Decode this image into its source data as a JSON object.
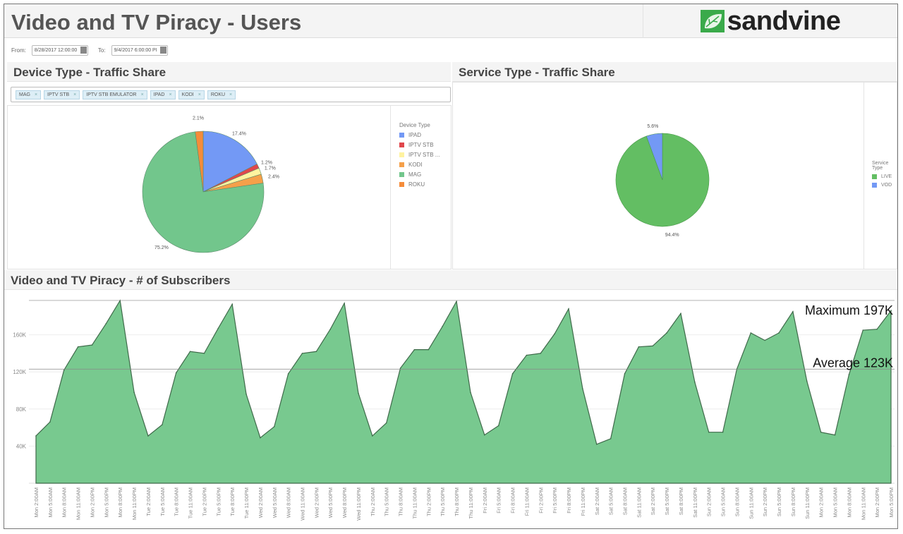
{
  "header": {
    "title": "Video and TV Piracy - Users",
    "logo_text": "sandvine"
  },
  "filter": {
    "from_label": "From:",
    "from_value": "8/28/2017 12:00:00",
    "to_label": "To:",
    "to_value": "9/4/2017 6:00:00 PI"
  },
  "device_panel": {
    "title": "Device Type - Traffic Share",
    "chips": [
      "MAG",
      "IPTV STB",
      "IPTV STB EMULATOR",
      "IPAD",
      "KODI",
      "ROKU"
    ],
    "legend_title": "Device Type",
    "chart_data": {
      "type": "pie",
      "slices": [
        {
          "name": "IPAD",
          "legend": "IPAD",
          "value": 17.4,
          "label": "17.4%",
          "color": "#7399f5"
        },
        {
          "name": "IPTV STB",
          "legend": "IPTV STB",
          "value": 1.2,
          "label": "1.2%",
          "color": "#e0474c"
        },
        {
          "name": "IPTV STB EMULATOR",
          "legend": "IPTV STB ...",
          "value": 1.7,
          "label": "1.7%",
          "color": "#fff3a0"
        },
        {
          "name": "KODI",
          "legend": "KODI",
          "value": 2.4,
          "label": "2.4%",
          "color": "#f5a04a"
        },
        {
          "name": "MAG",
          "legend": "MAG",
          "value": 75.2,
          "label": "75.2%",
          "color": "#72c68c"
        },
        {
          "name": "ROKU",
          "legend": "ROKU",
          "value": 2.1,
          "label": "2.1%",
          "color": "#f58c3a"
        }
      ]
    }
  },
  "service_panel": {
    "title": "Service Type - Traffic Share",
    "legend_title_1": "Service",
    "legend_title_2": "Type",
    "chart_data": {
      "type": "pie",
      "slices": [
        {
          "name": "LIVE",
          "value": 94.4,
          "label": "94.4%",
          "color": "#63be63"
        },
        {
          "name": "VOD",
          "value": 5.6,
          "label": "5.6%",
          "color": "#7399f5"
        }
      ]
    }
  },
  "subscribers_panel": {
    "title": "Video and TV Piracy - # of Subscribers",
    "chart_data": {
      "type": "area",
      "color": "#78c98f",
      "ylim": [
        0,
        200000
      ],
      "yticks": [
        {
          "v": 40000,
          "label": "40K"
        },
        {
          "v": 80000,
          "label": "80K"
        },
        {
          "v": 120000,
          "label": "120K"
        },
        {
          "v": 160000,
          "label": "160K"
        }
      ],
      "reference_lines": [
        {
          "label": "Maximum 197K",
          "value": 197000
        },
        {
          "label": "Average 123K",
          "value": 123000
        }
      ],
      "x": [
        "Mon 2:00AM",
        "Mon 5:00AM",
        "Mon 8:00AM",
        "Mon 11:00AM",
        "Mon 2:00PM",
        "Mon 5:00PM",
        "Mon 8:00PM",
        "Mon 11:00PM",
        "Tue 2:00AM",
        "Tue 5:00AM",
        "Tue 8:00AM",
        "Tue 11:00AM",
        "Tue 2:00PM",
        "Tue 5:00PM",
        "Tue 8:00PM",
        "Tue 11:00PM",
        "Wed 2:00AM",
        "Wed 5:00AM",
        "Wed 8:00AM",
        "Wed 11:00AM",
        "Wed 2:00PM",
        "Wed 5:00PM",
        "Wed 8:00PM",
        "Wed 11:00PM",
        "Thu 2:00AM",
        "Thu 5:00AM",
        "Thu 8:00AM",
        "Thu 11:00AM",
        "Thu 2:00PM",
        "Thu 5:00PM",
        "Thu 8:00PM",
        "Thu 11:00PM",
        "Fri 2:00AM",
        "Fri 5:00AM",
        "Fri 8:00AM",
        "Fri 11:00AM",
        "Fri 2:00PM",
        "Fri 5:00PM",
        "Fri 8:00PM",
        "Fri 11:00PM",
        "Sat 2:00AM",
        "Sat 5:00AM",
        "Sat 8:00AM",
        "Sat 11:00AM",
        "Sat 2:00PM",
        "Sat 5:00PM",
        "Sat 8:00PM",
        "Sat 11:00PM",
        "Sun 2:00AM",
        "Sun 5:00AM",
        "Sun 8:00AM",
        "Sun 11:00AM",
        "Sun 2:00PM",
        "Sun 5:00PM",
        "Sun 8:00PM",
        "Sun 11:00PM",
        "Mon 2:00AM",
        "Mon 5:00AM",
        "Mon 8:00AM",
        "Mon 11:00AM",
        "Mon 2:00PM",
        "Mon 5:00PM"
      ],
      "y": [
        51000,
        66000,
        122000,
        147000,
        149000,
        172000,
        197000,
        98000,
        51000,
        63000,
        119000,
        142000,
        140000,
        167000,
        193000,
        96000,
        49000,
        61000,
        118000,
        140000,
        142000,
        166000,
        194000,
        97000,
        51000,
        65000,
        124000,
        144000,
        144000,
        169000,
        196000,
        98000,
        52000,
        62000,
        118000,
        138000,
        140000,
        161000,
        188000,
        102000,
        42000,
        48000,
        118000,
        147000,
        148000,
        162000,
        183000,
        109000,
        55000,
        55000,
        123000,
        162000,
        154000,
        162000,
        185000,
        110000,
        55000,
        52000,
        117000,
        165000,
        166000,
        186000
      ]
    }
  }
}
